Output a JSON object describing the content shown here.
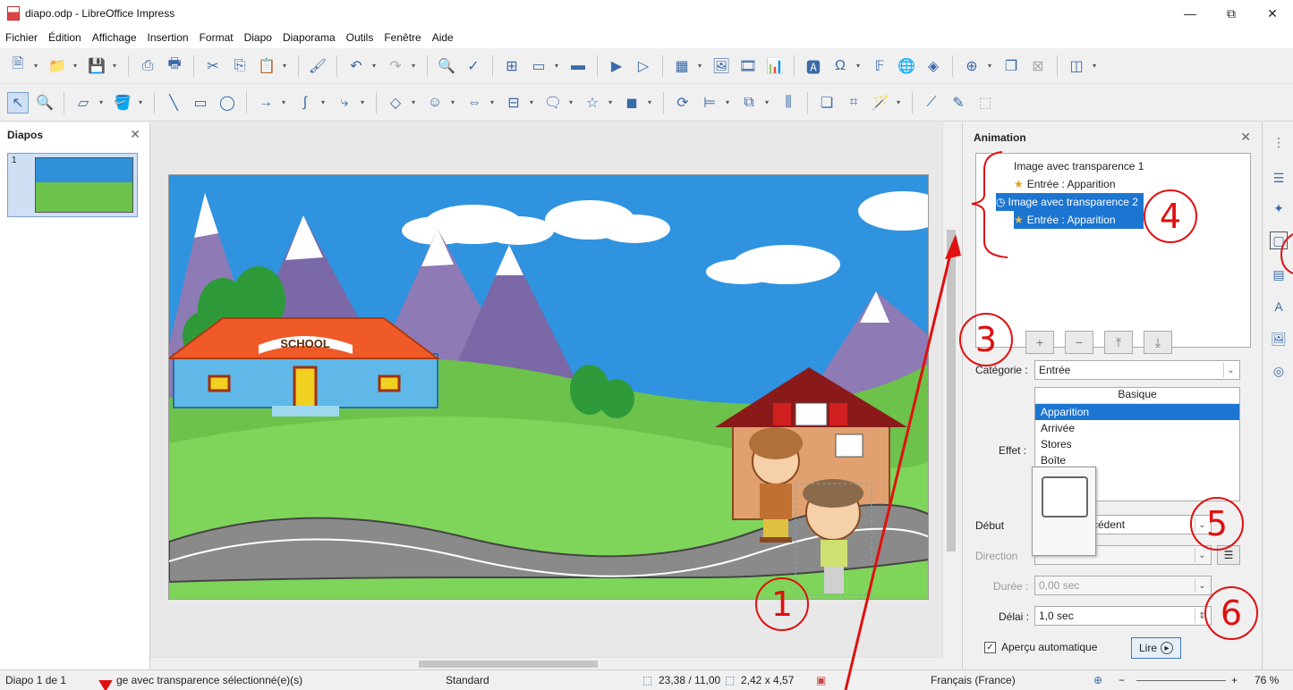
{
  "window": {
    "title": "diapo.odp - LibreOffice Impress",
    "minimize": "—",
    "restore": "⧉",
    "close": "✕"
  },
  "menu": [
    "Fichier",
    "Édition",
    "Affichage",
    "Insertion",
    "Format",
    "Diapo",
    "Diaporama",
    "Outils",
    "Fenêtre",
    "Aide"
  ],
  "slides_pane": {
    "title": "Diapos",
    "close": "✕",
    "slide_number": "1"
  },
  "slide": {
    "school_sign": "SCHOOL"
  },
  "animation": {
    "title": "Animation",
    "close": "✕",
    "list": [
      {
        "label": "Image avec transparence 1",
        "kind": "object"
      },
      {
        "label": "Entrée : Apparition",
        "kind": "effect"
      },
      {
        "label": "Image avec transparence 2",
        "kind": "object",
        "selected": true
      },
      {
        "label": "Entrée : Apparition",
        "kind": "effect",
        "selected": true
      }
    ],
    "buttons": {
      "add": "+",
      "remove": "−",
      "move_up": "⤒",
      "move_down": "⤓"
    },
    "category_label": "Catégorie :",
    "category_value": "Entrée",
    "effect_label": "Effet :",
    "effect_group": "Basique",
    "effects": [
      "Apparition",
      "Arrivée",
      "Stores",
      "Boîte"
    ],
    "selected_effect": "Apparition",
    "start_label": "Début",
    "start_value": "cédent",
    "direction_label": "Direction",
    "duration_label": "Durée :",
    "duration_value": "0,00 sec",
    "delay_label": "Délai :",
    "delay_value": "1,0 sec",
    "autopreview_label": "Aperçu automatique",
    "autopreview_checked": true,
    "play_label": "Lire"
  },
  "status": {
    "slide": "Diapo 1 de 1",
    "selection": "ge avec transparence sélectionné(e)(s)",
    "layout": "Standard",
    "position": "23,38 / 11,00",
    "size": "2,42 x 4,57",
    "language": "Français (France)",
    "zoom_minus": "−",
    "zoom_plus": "+",
    "zoom": "76 %"
  },
  "annotations": [
    "1",
    "3",
    "4",
    "5",
    "6"
  ],
  "colors": {
    "annotation": "#e01010",
    "selection": "#1c75d0",
    "sky": "#2f93e0",
    "grass": "#6cc24a"
  }
}
